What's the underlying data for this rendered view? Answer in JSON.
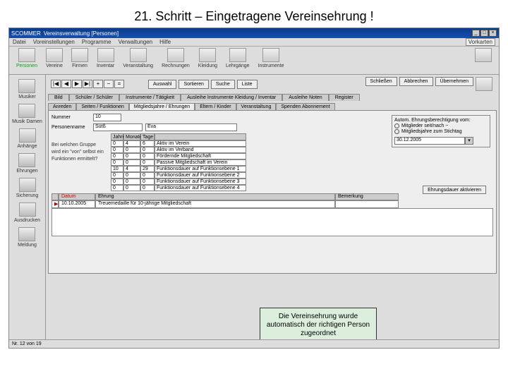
{
  "slide_title": "21. Schritt – Eingetragene Vereinsehrung !",
  "titlebar": {
    "app": "SCOMMER",
    "doc": "Vereinsverwaltung   [Personen]",
    "window_controls": [
      "_",
      "□",
      "×"
    ]
  },
  "menubar": [
    "Datei",
    "Voreinstellungen",
    "Programme",
    "Verwaltungen",
    "Hilfe"
  ],
  "lang_btn": "Vorkarten",
  "toolbar": [
    {
      "id": "personen",
      "label": "Personen",
      "selected": true
    },
    {
      "id": "vereine",
      "label": "Vereine"
    },
    {
      "id": "firmen",
      "label": "Firmen"
    },
    {
      "id": "inventar",
      "label": "Inventar"
    },
    {
      "id": "veranstaltung",
      "label": "Veranstaltung"
    },
    {
      "id": "rechnungen",
      "label": "Rechnungen"
    },
    {
      "id": "kleidung",
      "label": "Kleidung"
    },
    {
      "id": "lehrgaenge",
      "label": "Lehrgänge"
    },
    {
      "id": "instrumente",
      "label": "Instrumente"
    }
  ],
  "sidebar": [
    {
      "id": "musiker",
      "label": "Musiker"
    },
    {
      "id": "musik-damen",
      "label": "Musik Damen"
    },
    {
      "id": "anhange",
      "label": "Anhänge"
    },
    {
      "id": "ehrungen",
      "label": "Ehrungen"
    },
    {
      "id": "sicherung",
      "label": "Sicherung"
    },
    {
      "id": "ausdrucken",
      "label": "Ausdrucken"
    },
    {
      "id": "meldung",
      "label": "Meldung"
    }
  ],
  "nav_buttons": [
    "|◀",
    "◀",
    "▶",
    "▶|",
    "+",
    "−",
    "="
  ],
  "action_buttons": [
    "Auswahl",
    "Sortieren",
    "Suche",
    "Liste"
  ],
  "action_right": [
    "Schließen",
    "Abbrechen",
    "Übernehmen"
  ],
  "tabs1": [
    "Bild",
    "Schüler / Schüler",
    "Instrumente / Tätigkeit",
    "Ausleihe Instrumente Kleidung / Inventar",
    "Ausleihe Noten",
    "Register"
  ],
  "tabs2": [
    "Anreden",
    "Seiten / Funktionen",
    "Mitgliedsjahre / Ehrungen",
    "Eltern / Kinder",
    "Veranstaltung",
    "Spenden Abonnement"
  ],
  "tabs2_active": 2,
  "panel": {
    "nummer_label": "Nummer",
    "nummer": "10",
    "name_label": "Personenname",
    "vorname": "Sütß",
    "nachname": "Eva",
    "note_lines": [
      "Bei welchen Gruppe",
      "wird ein \"von\" selbst ein",
      "Funktionen ermittelt?"
    ],
    "grid_headers": [
      "Jahre",
      "Monate",
      "Tage",
      ""
    ],
    "grid_rows": [
      [
        "0",
        "4",
        "6",
        "Aktiv im Verein"
      ],
      [
        "0",
        "0",
        "0",
        "Aktiv im Verband"
      ],
      [
        "0",
        "0",
        "0",
        "Fördernde Mitgliedschaft"
      ],
      [
        "0",
        "0",
        "0",
        "Passive Mitgliedschaft im Verein"
      ],
      [
        "10",
        "4",
        "29",
        "Funktionsdauer auf Funktionsebene 1"
      ],
      [
        "0",
        "0",
        "0",
        "Funktionsdauer auf Funktionsebene 2"
      ],
      [
        "0",
        "0",
        "0",
        "Funktionsdauer auf Funktionsebene 3"
      ],
      [
        "0",
        "0",
        "0",
        "Funktionsdauer auf Funktionsebene 4"
      ]
    ],
    "autobox_title": "Autom. Ehrungsberechtigung vom:",
    "autobox_opt1": "Mitglieder seit/nach ~",
    "autobox_opt2": "Mitgliedsjahre zum Stichtag",
    "autobox_date": "30.12.2005",
    "mid_button": "Ehrungsdauer aktivieren",
    "entry_headers": [
      "",
      "Datum",
      "Ehrung",
      "Bemerkung"
    ],
    "entry_row": [
      "▶",
      "10.10.2005",
      "Treuemedaille für 10-jährige Mitgliedschaft",
      ""
    ]
  },
  "caption": "Die Vereinsehrung wurde automatisch der richtigen Person zugeordnet",
  "statusbar": "Nr. 12 von 19"
}
